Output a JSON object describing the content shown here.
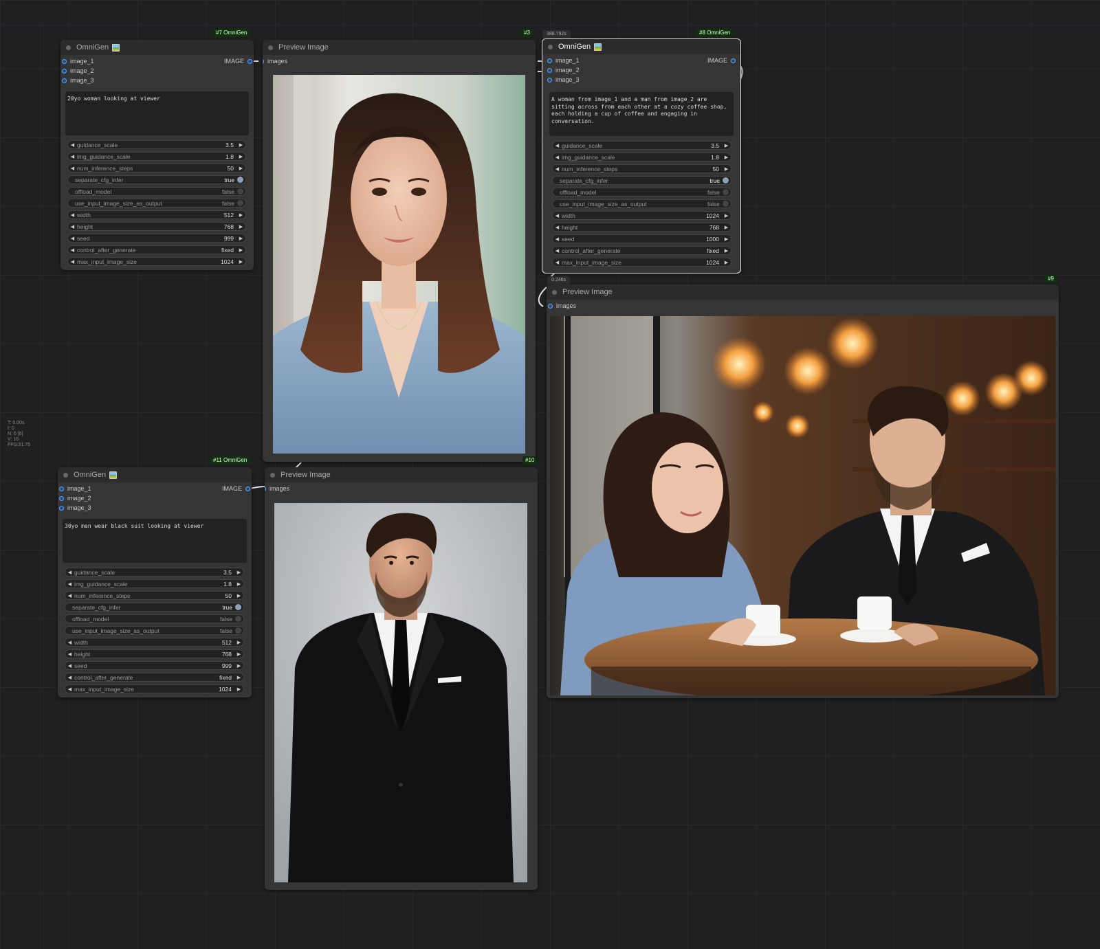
{
  "canvas": {
    "stats": [
      "T: 0.00s",
      "I: 0",
      "N: 6 [6]",
      "V: 16",
      "FPS:31.75"
    ]
  },
  "nodes": {
    "omnigen7": {
      "badge": "#7 OmniGen",
      "title": "OmniGen",
      "inputs": [
        "image_1",
        "image_2",
        "image_3"
      ],
      "output": "IMAGE",
      "prompt": "20yo woman looking at viewer",
      "widgets": [
        {
          "name": "guidance_scale",
          "value": "3.5",
          "type": "number"
        },
        {
          "name": "img_guidance_scale",
          "value": "1.8",
          "type": "number"
        },
        {
          "name": "num_inference_steps",
          "value": "50",
          "type": "number"
        },
        {
          "name": "separate_cfg_infer",
          "value": "true",
          "type": "toggle"
        },
        {
          "name": "offload_model",
          "value": "false",
          "type": "toggle"
        },
        {
          "name": "use_input_image_size_as_output",
          "value": "false",
          "type": "toggle"
        },
        {
          "name": "width",
          "value": "512",
          "type": "number"
        },
        {
          "name": "height",
          "value": "768",
          "type": "number"
        },
        {
          "name": "seed",
          "value": "999",
          "type": "number"
        },
        {
          "name": "control_after_generate",
          "value": "fixed",
          "type": "combo"
        },
        {
          "name": "max_input_image_size",
          "value": "1024",
          "type": "number"
        }
      ]
    },
    "preview3": {
      "badge": "#3",
      "title": "Preview Image",
      "input": "images"
    },
    "omnigen8": {
      "badge": "#8 OmniGen",
      "timing": "388.792s",
      "title": "OmniGen",
      "inputs": [
        "image_1",
        "image_2",
        "image_3"
      ],
      "output": "IMAGE",
      "prompt": "A woman from image_1 and a man from image_2 are sitting across from each other at a cozy coffee shop, each holding a cup of coffee and engaging in conversation.",
      "widgets": [
        {
          "name": "guidance_scale",
          "value": "3.5",
          "type": "number"
        },
        {
          "name": "img_guidance_scale",
          "value": "1.8",
          "type": "number"
        },
        {
          "name": "num_inference_steps",
          "value": "50",
          "type": "number"
        },
        {
          "name": "separate_cfg_infer",
          "value": "true",
          "type": "toggle"
        },
        {
          "name": "offload_model",
          "value": "false",
          "type": "toggle"
        },
        {
          "name": "use_input_image_size_as_output",
          "value": "false",
          "type": "toggle"
        },
        {
          "name": "width",
          "value": "1024",
          "type": "number"
        },
        {
          "name": "height",
          "value": "768",
          "type": "number"
        },
        {
          "name": "seed",
          "value": "1000",
          "type": "number"
        },
        {
          "name": "control_after_generate",
          "value": "fixed",
          "type": "combo"
        },
        {
          "name": "max_input_image_size",
          "value": "1024",
          "type": "number"
        }
      ]
    },
    "preview9": {
      "badge": "#9",
      "timing": "0.246s",
      "title": "Preview Image",
      "input": "images"
    },
    "omnigen11": {
      "badge": "#11 OmniGen",
      "title": "OmniGen",
      "inputs": [
        "image_1",
        "image_2",
        "image_3"
      ],
      "output": "IMAGE",
      "prompt": "30yo man wear black suit looking at viewer",
      "widgets": [
        {
          "name": "guidance_scale",
          "value": "3.5",
          "type": "number"
        },
        {
          "name": "img_guidance_scale",
          "value": "1.8",
          "type": "number"
        },
        {
          "name": "num_inference_steps",
          "value": "50",
          "type": "number"
        },
        {
          "name": "separate_cfg_infer",
          "value": "true",
          "type": "toggle"
        },
        {
          "name": "offload_model",
          "value": "false",
          "type": "toggle"
        },
        {
          "name": "use_input_image_size_as_output",
          "value": "false",
          "type": "toggle"
        },
        {
          "name": "width",
          "value": "512",
          "type": "number"
        },
        {
          "name": "height",
          "value": "768",
          "type": "number"
        },
        {
          "name": "seed",
          "value": "999",
          "type": "number"
        },
        {
          "name": "control_after_generate",
          "value": "fixed",
          "type": "combo"
        },
        {
          "name": "max_input_image_size",
          "value": "1024",
          "type": "number"
        }
      ]
    },
    "preview10": {
      "badge": "#10",
      "title": "Preview Image",
      "input": "images"
    }
  },
  "colors": {
    "canvas_bg": "#202020",
    "node_bg": "#353535",
    "node_title_bg": "#2b2b2b",
    "slot_input": "#5aa8ff",
    "badge_bg": "#103010",
    "selected_border": "#e8e8e8"
  }
}
